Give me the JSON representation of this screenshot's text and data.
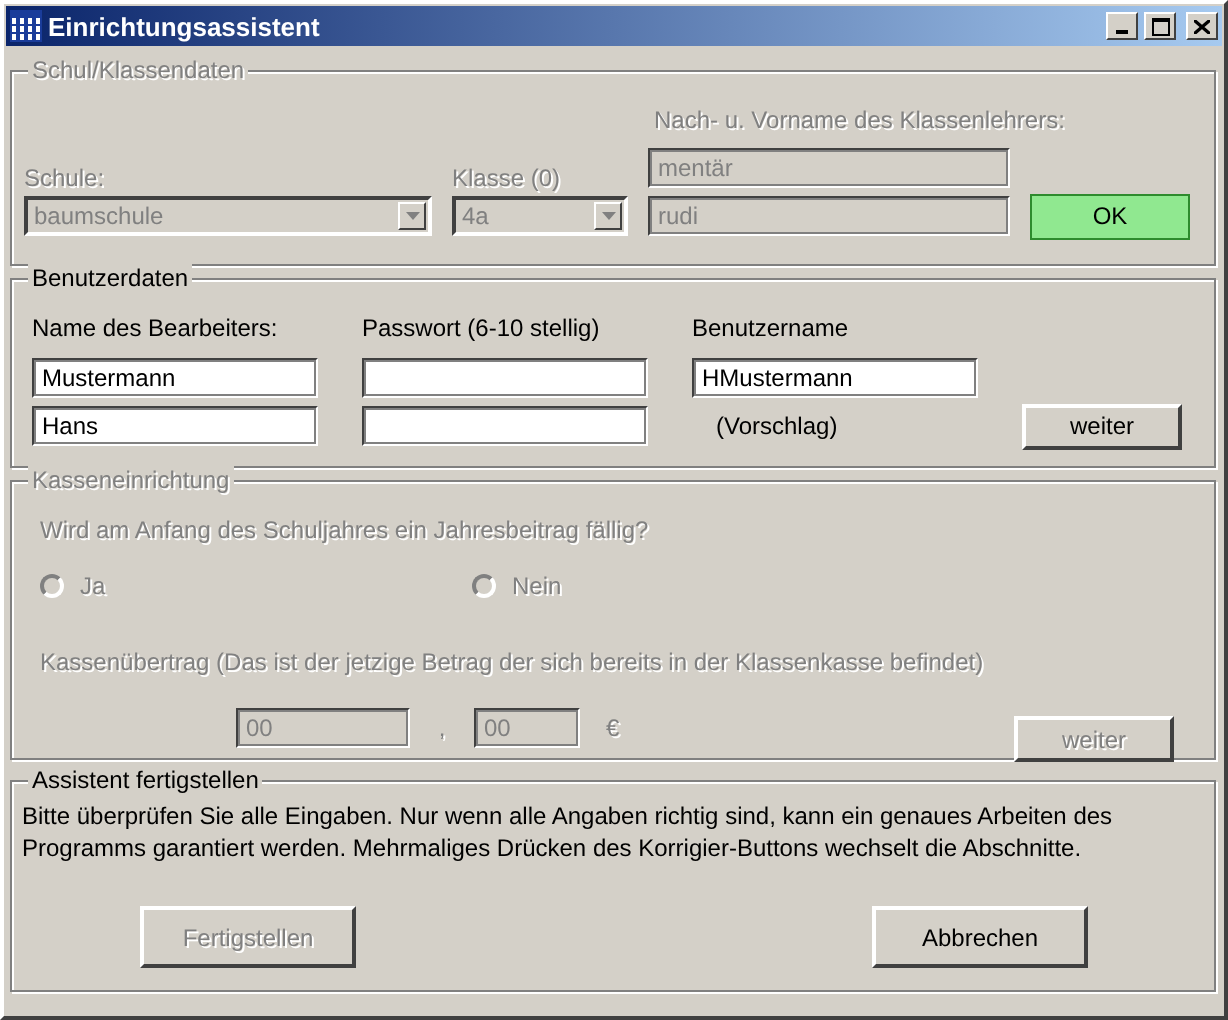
{
  "window": {
    "title": "Einrichtungsassistent"
  },
  "school_section": {
    "title": "Schul/Klassendaten",
    "disabled": true,
    "school_label": "Schule:",
    "school_value": "baumschule",
    "class_label": "Klasse (0)",
    "class_value": "4a",
    "teacher_label": "Nach- u. Vorname des Klassenlehrers:",
    "teacher_last_name": "mentär",
    "teacher_first_name": "rudi",
    "ok_button": "OK"
  },
  "user_section": {
    "title": "Benutzerdaten",
    "disabled": false,
    "name_label": "Name des Bearbeiters:",
    "last_name": "Mustermann",
    "first_name": "Hans",
    "password_label": "Passwort (6-10 stellig)",
    "username_label": "Benutzername",
    "username": "HMustermann",
    "suggestion_note": "(Vorschlag)",
    "next_button": "weiter"
  },
  "cash_section": {
    "title": "Kasseneinrichtung",
    "disabled": true,
    "question": "Wird am Anfang des Schuljahres ein Jahresbeitrag fällig?",
    "options": [
      {
        "label": "Ja",
        "selected": false
      },
      {
        "label": "Nein",
        "selected": false
      }
    ],
    "carryover_label": "Kassenübertrag (Das ist der jetzige Betrag der sich bereits in der Klassenkasse befindet)",
    "euros": "00",
    "separator": ",",
    "cents": "00",
    "currency": "€",
    "next_button": "weiter"
  },
  "finish_section": {
    "title": "Assistent fertigstellen",
    "message": "Bitte überprüfen Sie alle Eingaben. Nur wenn alle Angaben richtig sind, kann ein genaues Arbeiten des Programms garantiert werden. Mehrmaliges Drücken des Korrigier-Buttons wechselt die Abschnitte.",
    "finish_button": {
      "label": "Fertigstellen",
      "disabled": true
    },
    "cancel_button": "Abbrechen"
  }
}
